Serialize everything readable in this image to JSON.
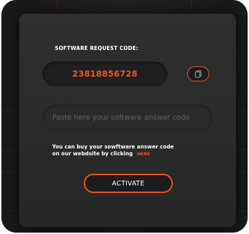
{
  "dialog": {
    "request_label": "SOFTWARE REQUEST CODE:",
    "request_code": "23818856728",
    "copy_icon": "copy-icon",
    "answer_placeholder": "Paste here your software answer code",
    "answer_value": "",
    "info_line1": "You can buy your sowftware answer code",
    "info_line2": "on our webdsite by clicking",
    "here_link": "HERE",
    "activate_label": "ACTIVATE"
  },
  "colors": {
    "accent": "#f0541e",
    "dialog_bg": "#2c2c2c",
    "window_bg": "#1b1b1b"
  }
}
